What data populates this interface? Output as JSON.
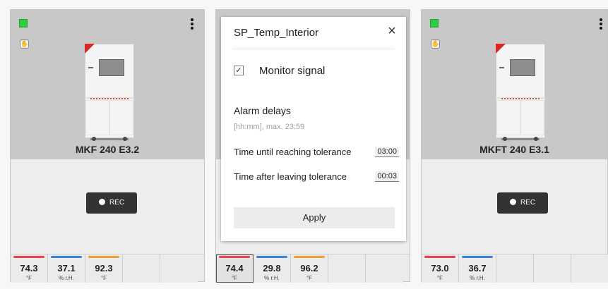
{
  "colors": {
    "status_green": "#2ecc40",
    "temp_red": "#e8424b",
    "humidity_blue": "#3b82e0",
    "temp2_orange": "#f0a030",
    "rec_bg": "#333333",
    "accent_red": "#d62828"
  },
  "cards": [
    {
      "title": "MKF 240 E3.2",
      "rec_label": "REC",
      "tiles": [
        {
          "value": "74.3",
          "unit": "°F",
          "color": "#e8424b"
        },
        {
          "value": "37.1",
          "unit": "% r.H.",
          "color": "#3b82e0"
        },
        {
          "value": "92.3",
          "unit": "°F",
          "color": "#f0a030"
        },
        {
          "value": "",
          "unit": "",
          "color": ""
        },
        {
          "value": "",
          "unit": "",
          "color": ""
        }
      ]
    },
    {
      "title": "",
      "rec_label": "",
      "tiles": [
        {
          "value": "74.4",
          "unit": "°F",
          "color": "#e8424b"
        },
        {
          "value": "29.8",
          "unit": "% r.H.",
          "color": "#3b82e0"
        },
        {
          "value": "96.2",
          "unit": "°F",
          "color": "#f0a030"
        },
        {
          "value": "",
          "unit": "",
          "color": ""
        },
        {
          "value": "",
          "unit": "",
          "color": ""
        }
      ]
    },
    {
      "title": "MKFT 240 E3.1",
      "rec_label": "REC",
      "tiles": [
        {
          "value": "73.0",
          "unit": "°F",
          "color": "#e8424b"
        },
        {
          "value": "36.7",
          "unit": "% r.H.",
          "color": "#3b82e0"
        },
        {
          "value": "",
          "unit": "",
          "color": ""
        },
        {
          "value": "",
          "unit": "",
          "color": ""
        },
        {
          "value": "",
          "unit": "",
          "color": ""
        }
      ]
    }
  ],
  "popup": {
    "title": "SP_Temp_Interior",
    "close_icon": "×",
    "checkbox_label": "Monitor signal",
    "checkbox_checked": true,
    "checkmark": "✓",
    "alarm_title": "Alarm delays",
    "alarm_hint": "[hh:mm], max. 23:59",
    "rows": [
      {
        "label": "Time until reaching tolerance",
        "value": "03:00"
      },
      {
        "label": "Time after leaving tolerance",
        "value": "00:03"
      }
    ],
    "apply_label": "Apply"
  }
}
